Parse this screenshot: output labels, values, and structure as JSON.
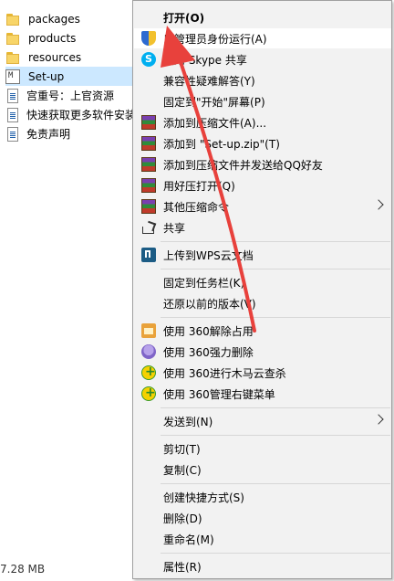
{
  "explorer": {
    "files": [
      {
        "name": "packages",
        "icon": "folder-icon"
      },
      {
        "name": "products",
        "icon": "folder-icon"
      },
      {
        "name": "resources",
        "icon": "folder-icon"
      },
      {
        "name": "Set-up",
        "icon": "exe-icon",
        "selected": true
      },
      {
        "name": "宫重号：上官资源",
        "icon": "doc-icon"
      },
      {
        "name": "快速获取更多软件安装",
        "icon": "doc-icon"
      },
      {
        "name": "免责声明",
        "icon": "doc-icon"
      }
    ],
    "status_size": "7.28 MB"
  },
  "context_menu": {
    "items": [
      {
        "label": "打开(O)",
        "icon": "",
        "bold": true
      },
      {
        "label": "以管理员身份运行(A)",
        "icon": "shield-icon",
        "hover": true
      },
      {
        "label": "使用 Skype 共享",
        "icon": "skype-icon"
      },
      {
        "label": "兼容性疑难解答(Y)",
        "icon": ""
      },
      {
        "label": "固定到\"开始\"屏幕(P)",
        "icon": ""
      },
      {
        "label": "添加到压缩文件(A)...",
        "icon": "winrar-icon"
      },
      {
        "label": "添加到 \"Set-up.zip\"(T)",
        "icon": "winrar-icon"
      },
      {
        "label": "添加到压缩文件并发送给QQ好友",
        "icon": "winrar-icon"
      },
      {
        "label": "用好压打开(Q)",
        "icon": "winrar-icon"
      },
      {
        "label": "其他压缩命令",
        "icon": "winrar-icon",
        "submenu": true
      },
      {
        "label": "共享",
        "icon": "share-icon"
      },
      {
        "separator": true
      },
      {
        "label": "上传到WPS云文档",
        "icon": "wps-icon"
      },
      {
        "separator": true
      },
      {
        "label": "固定到任务栏(K)",
        "icon": ""
      },
      {
        "label": "还原以前的版本(V)",
        "icon": ""
      },
      {
        "separator": true
      },
      {
        "label": "使用 360解除占用",
        "icon": "unlock360-icon"
      },
      {
        "label": "使用 360强力删除",
        "icon": "delete360-icon"
      },
      {
        "label": "使用 360进行木马云查杀",
        "icon": "scan360-icon"
      },
      {
        "label": "使用 360管理右键菜单",
        "icon": "rmenu360-icon"
      },
      {
        "separator": true
      },
      {
        "label": "发送到(N)",
        "icon": "",
        "submenu": true
      },
      {
        "separator": true
      },
      {
        "label": "剪切(T)",
        "icon": ""
      },
      {
        "label": "复制(C)",
        "icon": ""
      },
      {
        "separator": true
      },
      {
        "label": "创建快捷方式(S)",
        "icon": ""
      },
      {
        "label": "删除(D)",
        "icon": ""
      },
      {
        "label": "重命名(M)",
        "icon": ""
      },
      {
        "separator": true
      },
      {
        "label": "属性(R)",
        "icon": ""
      }
    ]
  },
  "colors": {
    "selection": "#cce8ff",
    "menu_bg": "#f2f2f2",
    "annotation_arrow": "#e8413c"
  }
}
